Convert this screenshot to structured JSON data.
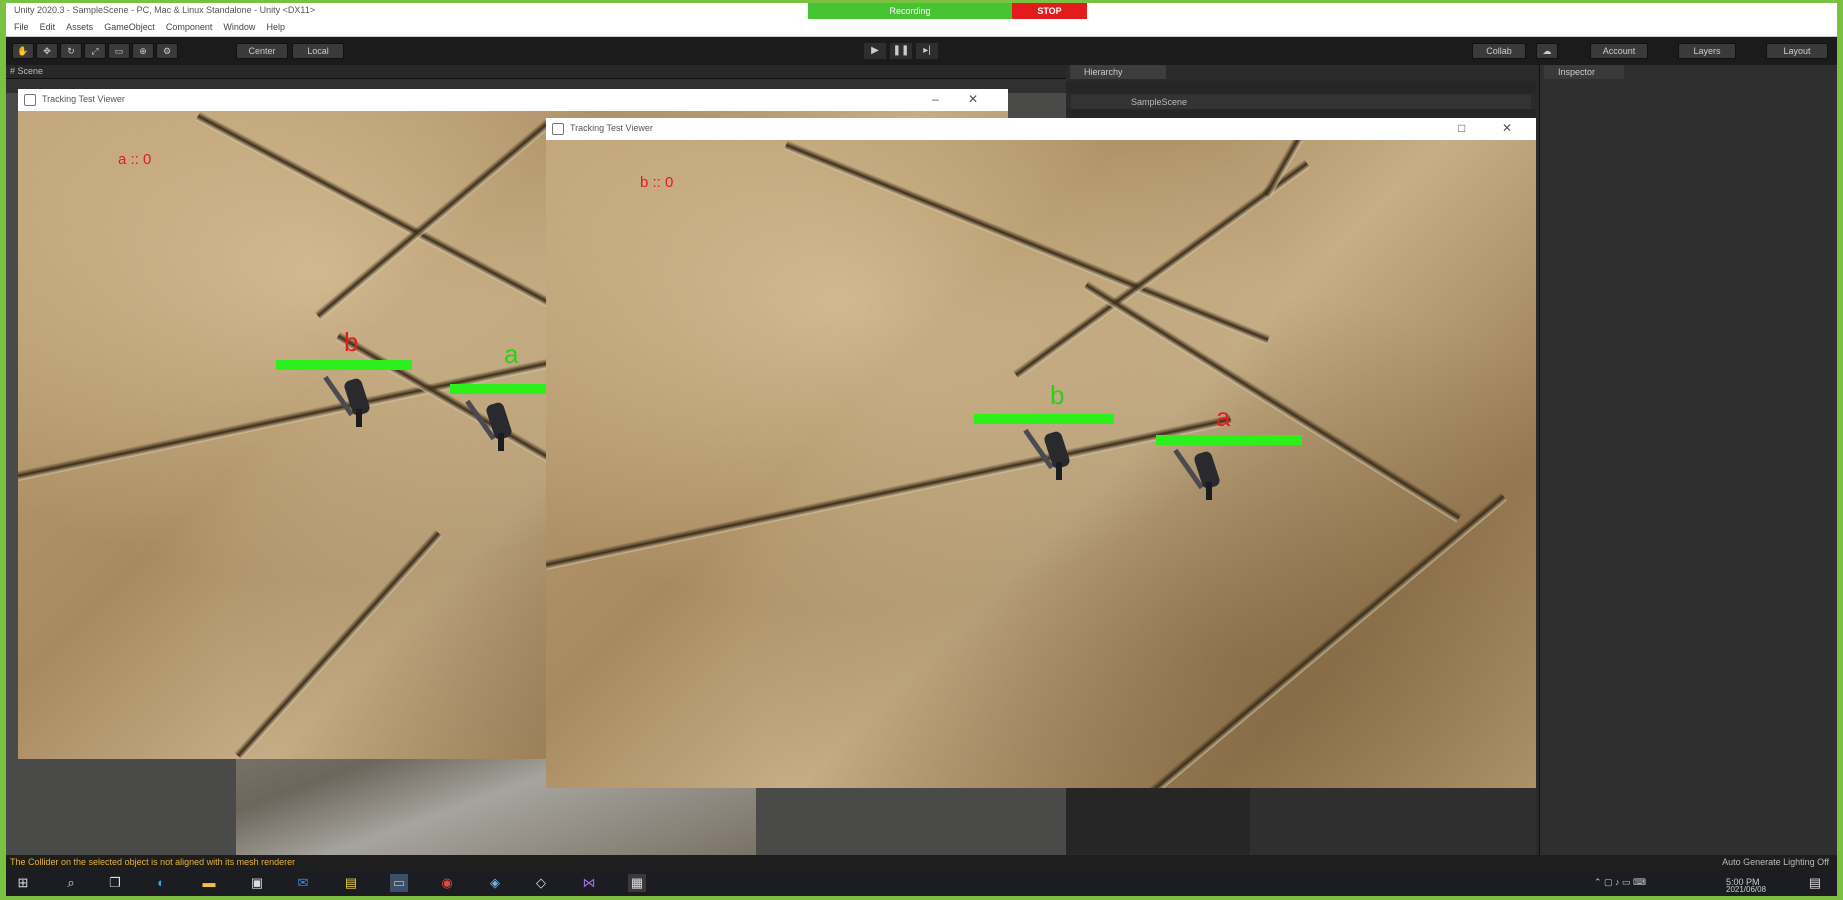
{
  "titlebar": {
    "text": "Unity 2020.3 - SampleScene - PC, Mac & Linux Standalone - Unity <DX11>",
    "recording": "Recording",
    "stop": "STOP"
  },
  "menu": [
    "File",
    "Edit",
    "Assets",
    "GameObject",
    "Component",
    "Window",
    "Help"
  ],
  "toolbar": {
    "center_label": "Center",
    "local_label": "Local",
    "collab_label": "Collab",
    "account_label": "Account",
    "layers_label": "Layers",
    "layout_label": "Layout"
  },
  "panels": {
    "scene_tab": "# Scene",
    "hierarchy_tab": "Hierarchy",
    "hierarchy_item": "SampleScene",
    "inspector_tab": "Inspector"
  },
  "window_left": {
    "title": "Tracking Test Viewer",
    "debug_text": "a :: 0",
    "label_b": "b",
    "label_a": "a"
  },
  "window_right": {
    "title": "Tracking Test Viewer",
    "debug_text": "b :: 0",
    "label_b": "b",
    "label_a": "a"
  },
  "statusbar": {
    "warning": "The Collider on the selected object is not aligned with its mesh renderer",
    "right": "Auto Generate Lighting Off"
  },
  "taskbar": {
    "icons": [
      "windows-start",
      "search",
      "task-view",
      "edge",
      "file-explorer",
      "store",
      "mail",
      "sticky",
      "folder",
      "chrome",
      "explorer2",
      "unity",
      "visual-studio",
      "app"
    ],
    "time": "5:00 PM",
    "date": "2021/06/08"
  }
}
